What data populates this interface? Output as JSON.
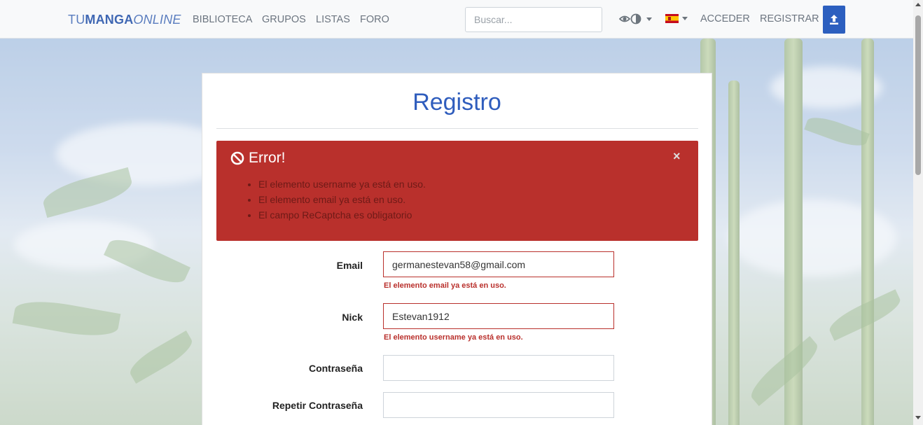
{
  "nav": {
    "brand_prefix": "TU",
    "brand_main": "MANGA",
    "brand_suffix": "ONLINE",
    "links": [
      "BIBLIOTECA",
      "GRUPOS",
      "LISTAS",
      "FORO"
    ],
    "search_placeholder": "Buscar...",
    "view_icon": "eye-toggle-icon",
    "language_flag": "spain-flag-icon",
    "login": "ACCEDER",
    "register": "REGISTRAR",
    "upload_icon": "upload-icon"
  },
  "colors": {
    "brand_blue": "#2c5fbf",
    "alert_red": "#b9302c",
    "error_text": "#b9302c"
  },
  "page": {
    "title": "Registro",
    "alert": {
      "icon": "ban-icon",
      "heading": "Error!",
      "close": "×",
      "messages": [
        "El elemento username ya está en uso.",
        "El elemento email ya está en uso.",
        "El campo ReCaptcha es obligatorio"
      ]
    },
    "form": {
      "email": {
        "label": "Email",
        "value": "germanestevan58@gmail.com",
        "error": "El elemento email ya está en uso."
      },
      "nick": {
        "label": "Nick",
        "value": "Estevan1912",
        "error": "El elemento username ya está en uso."
      },
      "password": {
        "label": "Contraseña",
        "value": ""
      },
      "repeat_password": {
        "label": "Repetir Contraseña",
        "value": ""
      }
    }
  }
}
